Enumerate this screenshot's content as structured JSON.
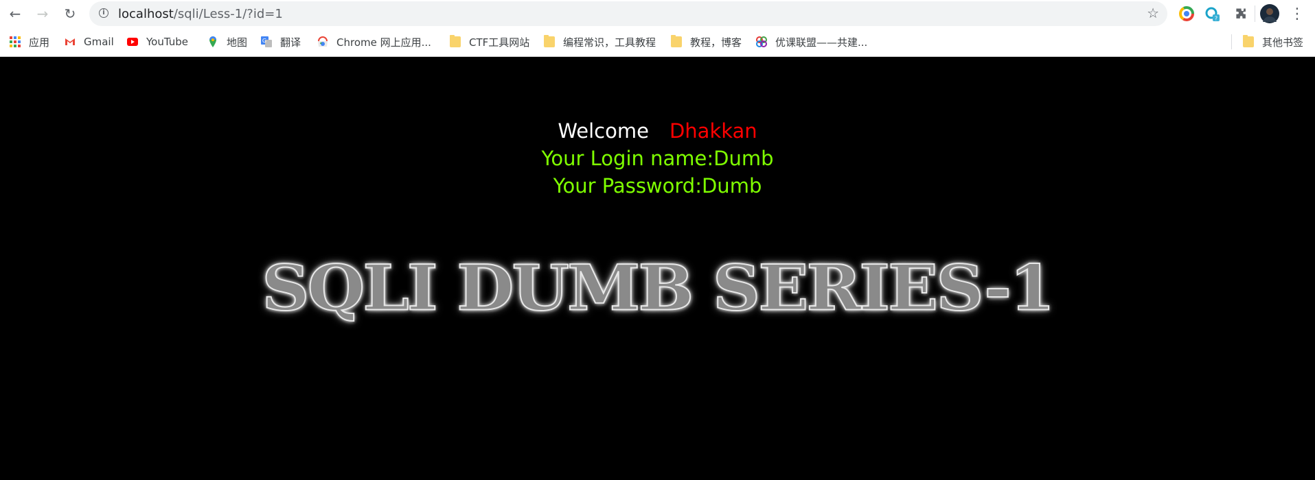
{
  "browser": {
    "url_host": "localhost",
    "url_path": "/sqli/Less-1/?id=1",
    "bookmarks": [
      {
        "label": "应用",
        "icon": "apps-grid-icon"
      },
      {
        "label": "Gmail",
        "icon": "gmail-icon"
      },
      {
        "label": "YouTube",
        "icon": "youtube-icon"
      },
      {
        "label": "地图",
        "icon": "maps-pin-icon"
      },
      {
        "label": "翻译",
        "icon": "translate-icon"
      },
      {
        "label": "Chrome 网上应用...",
        "icon": "chrome-webstore-icon"
      },
      {
        "label": "CTF工具网站",
        "icon": "folder-icon"
      },
      {
        "label": "编程常识，工具教程",
        "icon": "folder-icon"
      },
      {
        "label": "教程，博客",
        "icon": "folder-icon"
      },
      {
        "label": "优课联盟——共建...",
        "icon": "site-logo-icon"
      },
      {
        "label": "其他书签",
        "icon": "folder-icon"
      }
    ]
  },
  "page": {
    "welcome_label": "Welcome",
    "welcome_name": "Dhakkan",
    "login_name_line": "Your Login name:Dumb",
    "password_line": "Your Password:Dumb",
    "banner_text": "SQLI DUMB SERIES-1"
  },
  "colors": {
    "background": "#000000",
    "welcome_name": "#ff0000",
    "credentials": "#7fff00"
  }
}
